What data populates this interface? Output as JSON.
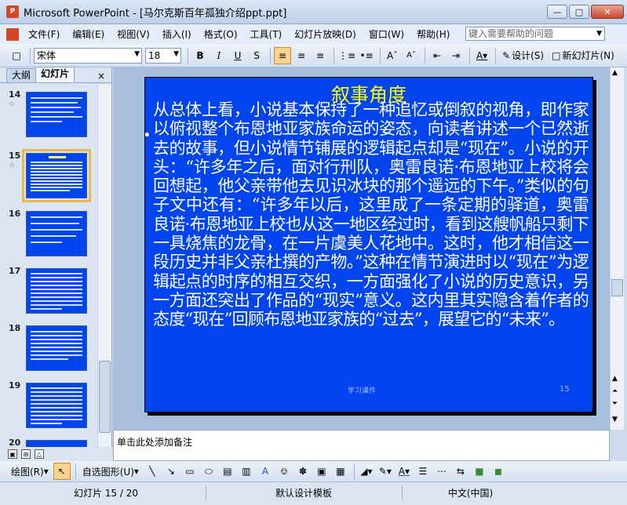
{
  "window": {
    "title": "Microsoft PowerPoint - [马尔克斯百年孤独介绍ppt.ppt]",
    "app_icon": "P"
  },
  "menu": [
    "文件(F)",
    "编辑(E)",
    "视图(V)",
    "插入(I)",
    "格式(O)",
    "工具(T)",
    "幻灯片放映(D)",
    "窗口(W)",
    "帮助(H)"
  ],
  "help_placeholder": "键入需要帮助的问题",
  "toolbar": {
    "font_name": "宋体",
    "font_size": "18",
    "design_label": "设计(S)",
    "new_slide_label": "新幻灯片(N)"
  },
  "left_pane": {
    "tab_outline": "大纲",
    "tab_slides": "幻灯片",
    "close": "×",
    "thumbs": [
      {
        "num": "14",
        "star": "☆"
      },
      {
        "num": "15",
        "star": "☆"
      },
      {
        "num": "16",
        "star": ""
      },
      {
        "num": "17",
        "star": ""
      },
      {
        "num": "18",
        "star": ""
      },
      {
        "num": "19",
        "star": ""
      },
      {
        "num": "20",
        "star": ""
      }
    ]
  },
  "slide": {
    "title": "叙事角度",
    "bullet": "•",
    "body": "从总体上看，小说基本保持了一种追忆或倒叙的视角，即作家以俯视整个布恩地亚家族命运的姿态，向读者讲述一个已然逝去的故事，但小说情节铺展的逻辑起点却是“现在”。小说的开头：“许多年之后，面对行刑队，奥雷良诺·布恩地亚上校将会回想起，他父亲带他去见识冰块的那个遥远的下午。”类似的句子文中还有：“许多年以后，这里成了一条定期的驿道，奥雷良诺·布恩地亚上校也从这一地区经过时，看到这艘帆船只剩下一具烧焦的龙骨，在一片虞美人花地中。这时，他才相信这一段历史并非父亲杜撰的产物。”这种在情节演进时以“现在”为逻辑起点的时序的相互交织，一方面强化了小说的历史意识，另一方面还突出了作品的“现实”意义。这内里其实隐含着作者的态度“现在”回顾布恩地亚家族的“过去”，展望它的“未来”。",
    "footer": "学习课件",
    "page_num": "15"
  },
  "notes_placeholder": "单击此处添加备注",
  "drawing": {
    "draw_label": "绘图(R)",
    "autoshape_label": "自选图形(U)"
  },
  "status": {
    "slide": "幻灯片 15 / 20",
    "template": "默认设计模板",
    "language": "中文(中国)"
  }
}
